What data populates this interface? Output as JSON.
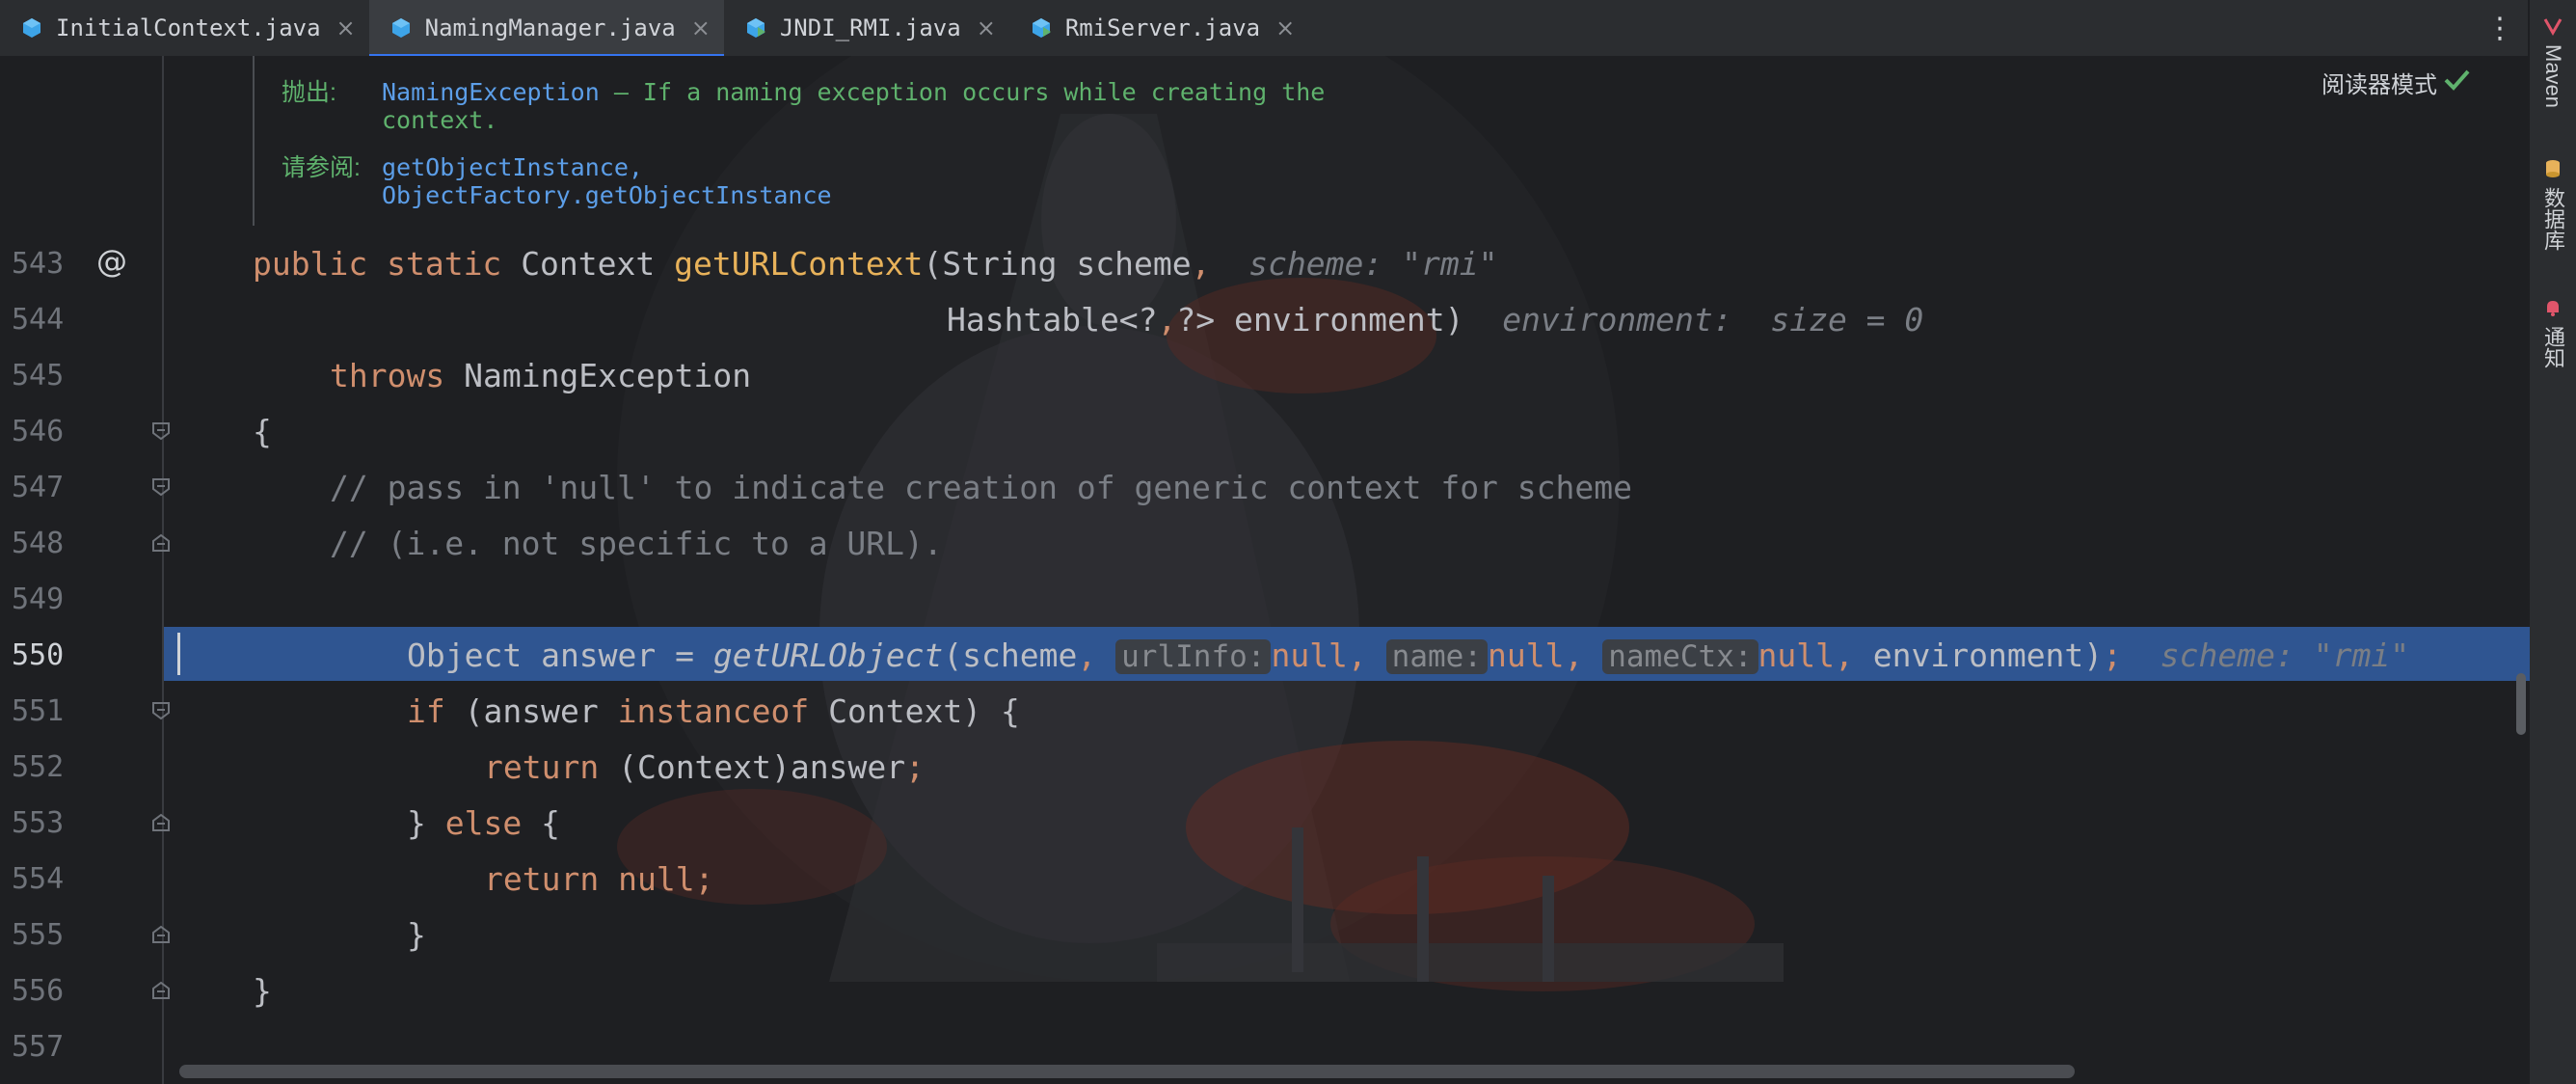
{
  "tabs": [
    {
      "label": "InitialContext.java",
      "active": false,
      "icon": "java-class-icon"
    },
    {
      "label": "NamingManager.java",
      "active": true,
      "icon": "java-class-icon"
    },
    {
      "label": "JNDI_RMI.java",
      "active": false,
      "icon": "java-runnable-class-icon"
    },
    {
      "label": "RmiServer.java",
      "active": false,
      "icon": "java-runnable-class-icon"
    }
  ],
  "tab_close": "×",
  "tab_more": "⋮",
  "tool_windows": [
    {
      "label": "Maven",
      "icon": "maven-icon"
    },
    {
      "label": "数据库",
      "icon": "database-icon"
    },
    {
      "label": "通知",
      "icon": "notification-icon"
    }
  ],
  "reader_mode": "阅读器模式",
  "javadoc": {
    "throws_label": "抛出:",
    "throws_link": "NamingException",
    "throws_text_1": " – If a naming exception occurs while creating the",
    "throws_text_2": "context.",
    "see_label": "请参阅:",
    "see_link_1": "getObjectInstance,",
    "see_link_2": "ObjectFactory.getObjectInstance"
  },
  "line_numbers": [
    "543",
    "544",
    "545",
    "546",
    "547",
    "548",
    "549",
    "550",
    "551",
    "552",
    "553",
    "554",
    "555",
    "556",
    "557"
  ],
  "current_line": "550",
  "gutter_annotation": "@",
  "code": {
    "l543": {
      "kw1": "public",
      "kw2": "static",
      "type": "Context",
      "fn": "getURLContext",
      "rest": "(String scheme",
      "comma": ",",
      "hint": "scheme: \"rmi\""
    },
    "l544": {
      "text": "Hashtable<?",
      "comma": ",",
      "text2": "?> environment)",
      "hint": "environment:  size = 0"
    },
    "l545": {
      "kw": "throws",
      "text": "NamingException"
    },
    "l546": {
      "text": "{"
    },
    "l547": {
      "comment": "// pass in 'null' to indicate creation of generic context for scheme"
    },
    "l548": {
      "comment": "// (i.e. not specific to a URL)."
    },
    "l550": {
      "pre": "Object answer = ",
      "fn": "getURLObject",
      "args": "(scheme",
      "comma1": ",",
      "inlay1": "urlInfo:",
      "null1": "null,",
      "inlay2": "name:",
      "null2": "null,",
      "inlay3": "nameCtx:",
      "null3": "null,",
      "env": "environment)",
      "semi": ";",
      "hint": "scheme: \"rmi\""
    },
    "l551": {
      "kw": "if",
      "t1": "(answer ",
      "kw2": "instanceof",
      "t2": " Context) {"
    },
    "l552": {
      "kw": "return",
      "t": " (Context)answer",
      "semi": ";"
    },
    "l553": {
      "t1": "} ",
      "kw": "else",
      "t2": " {"
    },
    "l554": {
      "kw": "return",
      "kw2": " null",
      "semi": ";"
    },
    "l555": {
      "text": "}"
    },
    "l556": {
      "text": "}"
    }
  },
  "colors": {
    "keyword": "#cf8e6d",
    "function": "#e8b25a",
    "comment": "#7a7e85",
    "javadoc_text": "#5fb26d",
    "javadoc_link": "#5c9ee8",
    "execution_highlight": "#2f5591"
  }
}
